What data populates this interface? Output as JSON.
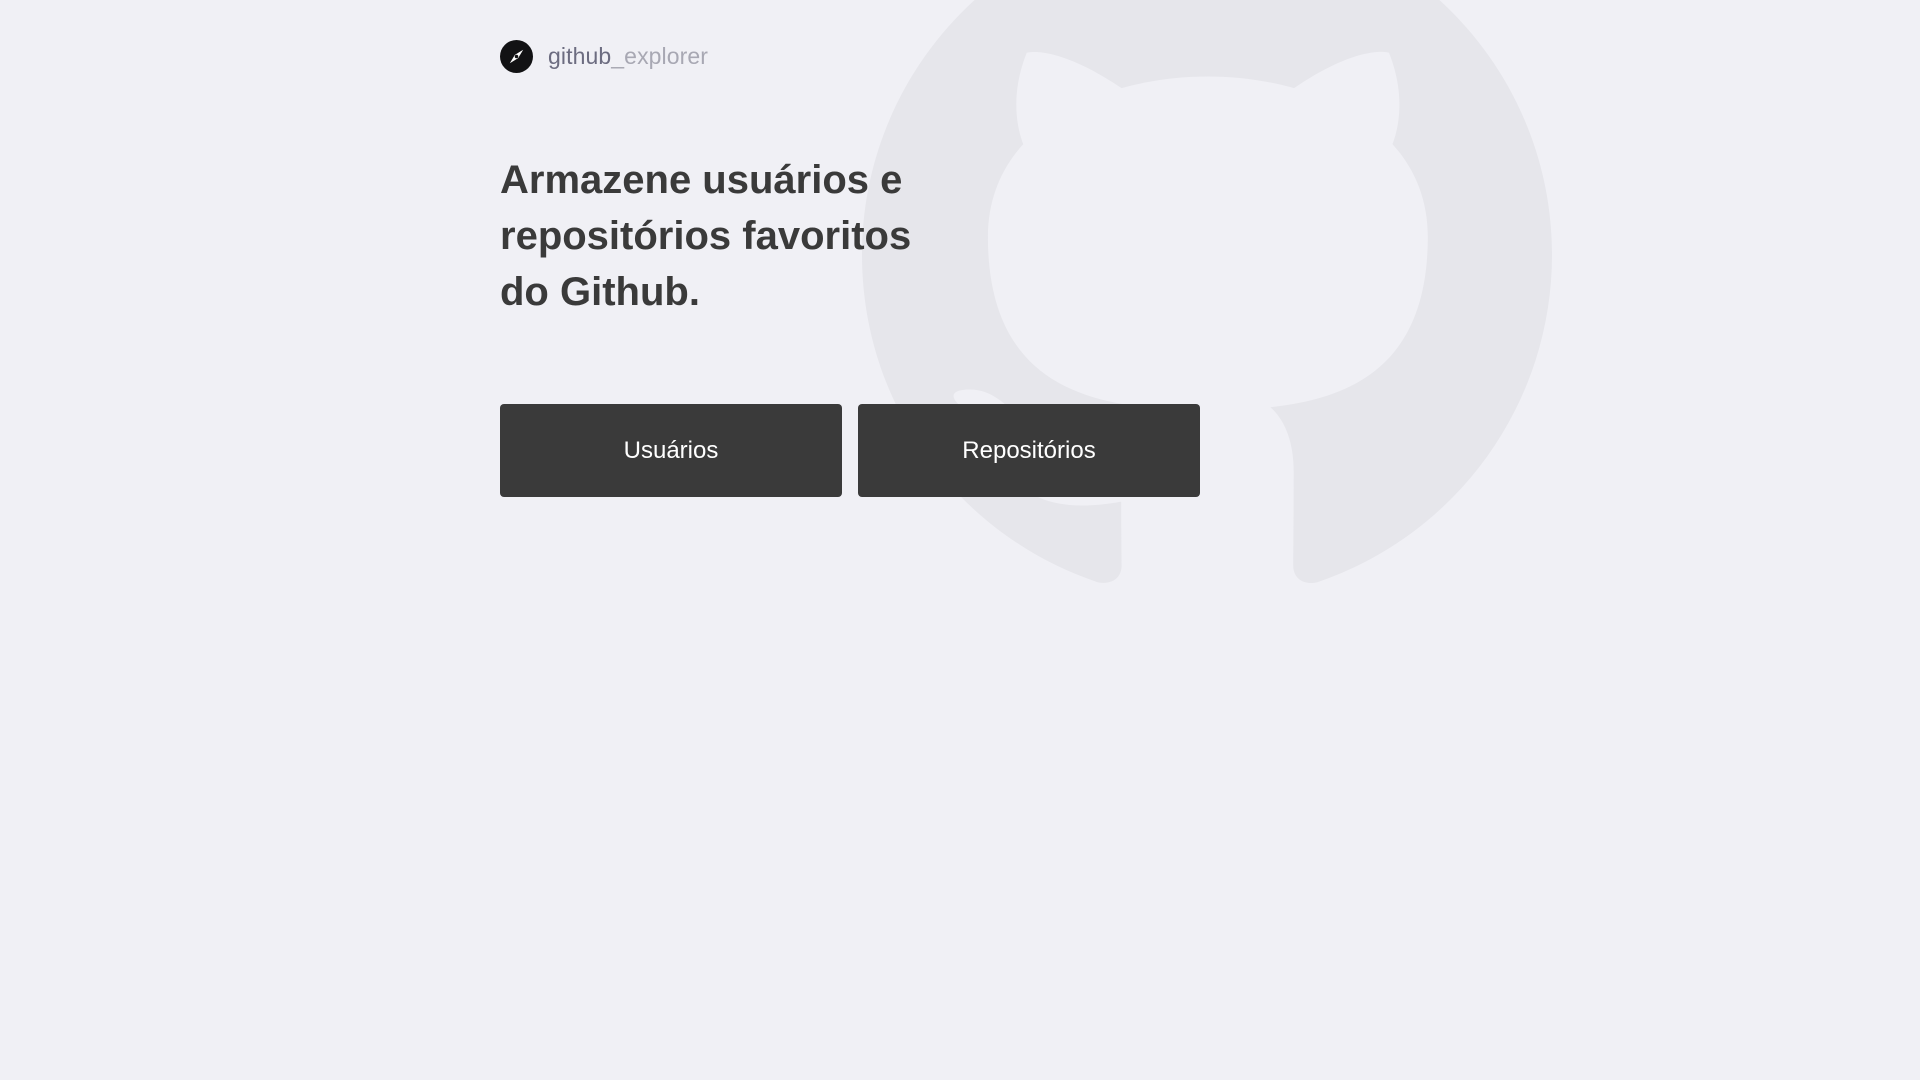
{
  "brand": {
    "icon": "compass-icon",
    "name_part1": "github",
    "name_part2": "_explorer"
  },
  "hero": {
    "title": "Armazene usuários e repositórios favoritos do Github."
  },
  "buttons": {
    "users_label": "Usuários",
    "repos_label": "Repositórios"
  },
  "background": {
    "icon": "github-octocat-icon"
  },
  "colors": {
    "page_background": "#f0f0f5",
    "title_text": "#3a3a3a",
    "button_background": "#3a3a3a",
    "button_text": "#ffffff",
    "brand_dark": "#6c6c80",
    "brand_light": "#a8a8b3"
  }
}
